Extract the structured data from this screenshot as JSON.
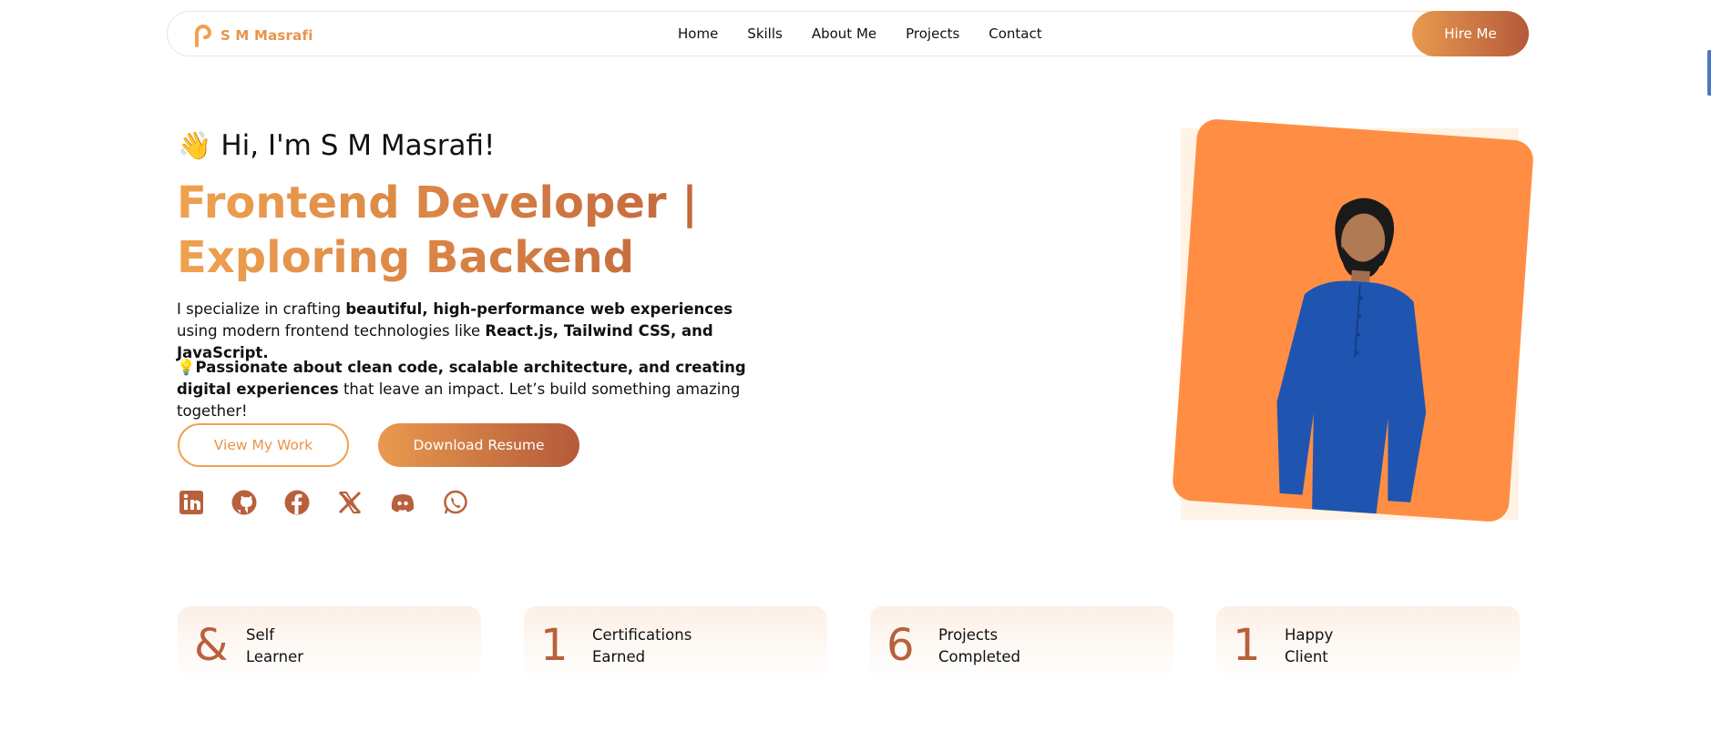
{
  "nav": {
    "logo_text": "S M Masrafi",
    "items": [
      {
        "label": "Home"
      },
      {
        "label": "Skills"
      },
      {
        "label": "About Me"
      },
      {
        "label": "Projects"
      },
      {
        "label": "Contact"
      }
    ],
    "hire_label": "Hire Me"
  },
  "hero": {
    "wave": "👋",
    "greeting": "Hi, I'm S M Masrafi!",
    "headline_line1": "Frontend Developer |",
    "headline_line2": "Exploring Backend",
    "p1_a": "I specialize in crafting ",
    "p1_b": "beautiful, high-performance web experiences",
    "p1_c": " using modern frontend technologies like ",
    "p1_d": "React.js, Tailwind CSS, and JavaScript.",
    "p2_icon": "💡",
    "p2_a": "Passionate about clean code, scalable architecture, and creating digital experiences",
    "p2_b": " that leave an impact. Let’s build something amazing together!",
    "view_work": "View My Work",
    "download_resume": "Download Resume"
  },
  "socials": [
    "linkedin-icon",
    "github-icon",
    "facebook-icon",
    "x-icon",
    "discord-icon",
    "whatsapp-icon"
  ],
  "stats": [
    {
      "num": "&",
      "line1": "Self",
      "line2": "Learner"
    },
    {
      "num": "1",
      "line1": "Certifications",
      "line2": "Earned"
    },
    {
      "num": "6",
      "line1": "Projects",
      "line2": "Completed"
    },
    {
      "num": "1",
      "line1": "Happy",
      "line2": "Client"
    }
  ],
  "colors": {
    "accent_start": "#f0a24f",
    "accent_end": "#b45a3a",
    "photo_bg": "#ff8e44",
    "icon": "#b8603c"
  }
}
